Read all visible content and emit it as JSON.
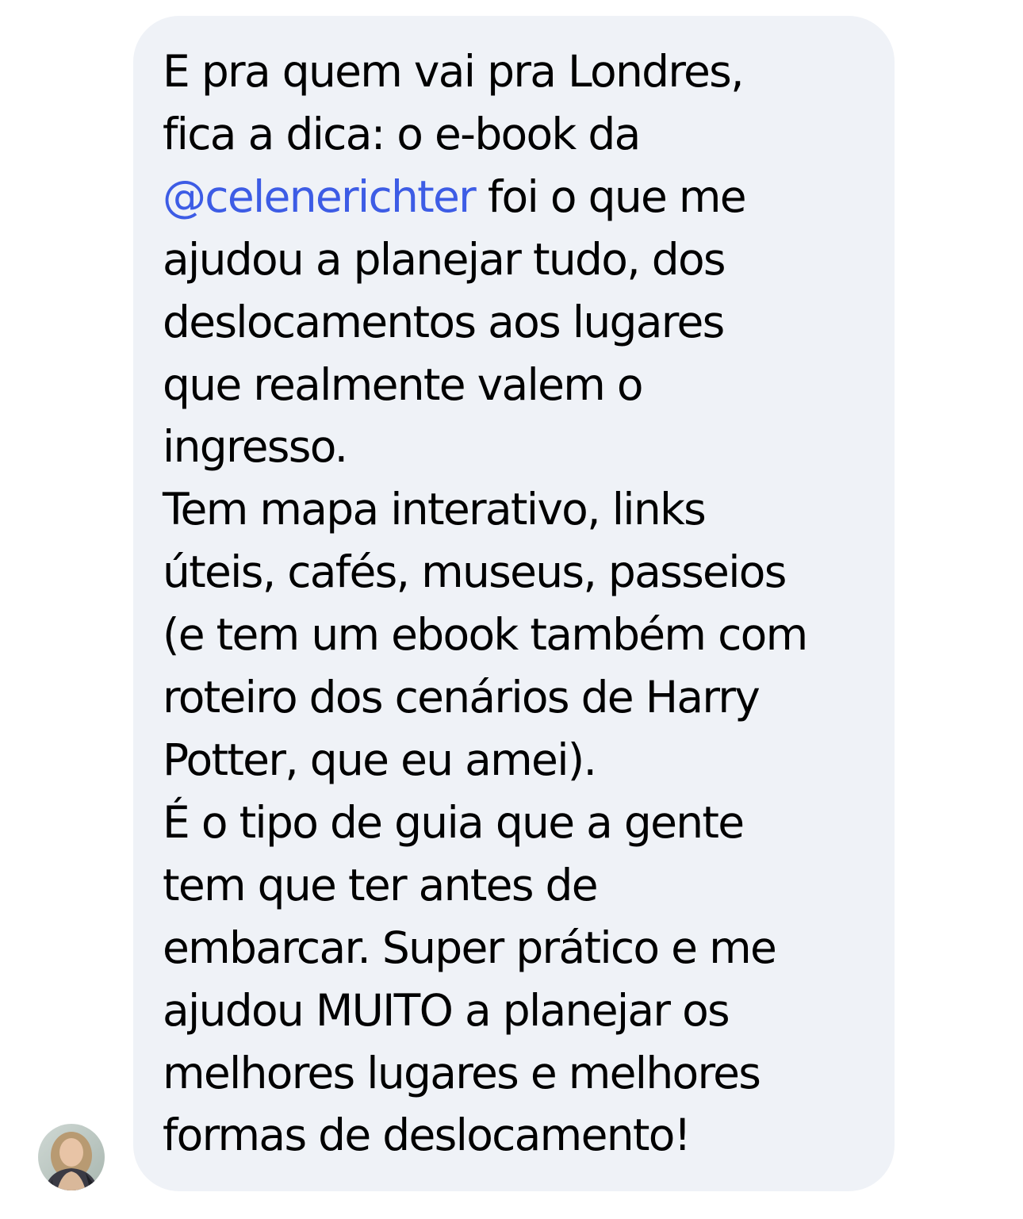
{
  "message": {
    "paragraphs": [
      {
        "lines": [
          "E pra quem vai pra Londres,",
          "fica a dica: o e-book da"
        ],
        "mention_line": {
          "mention": "@celenerichter",
          "rest": " foi o que me"
        },
        "lines_after": [
          "ajudou a planejar tudo, dos",
          "deslocamentos aos lugares",
          "que realmente valem o",
          "ingresso."
        ]
      },
      {
        "lines": [
          "Tem mapa interativo, links",
          "úteis, cafés, museus, passeios",
          "(e tem um ebook também com",
          "roteiro dos cenários de Harry",
          "Potter, que eu amei)."
        ]
      },
      {
        "lines": [
          "É o tipo de guia que a gente",
          "tem que ter antes de",
          "embarcar. Super prático e me",
          "ajudou MUITO a planejar os",
          "melhores lugares e melhores",
          "formas de deslocamento!"
        ]
      }
    ]
  },
  "colors": {
    "bubble_background": "#eff2f7",
    "mention": "#3d5ce5",
    "text": "#000000"
  },
  "sender": {
    "avatar_icon": "profile-photo-avatar"
  }
}
